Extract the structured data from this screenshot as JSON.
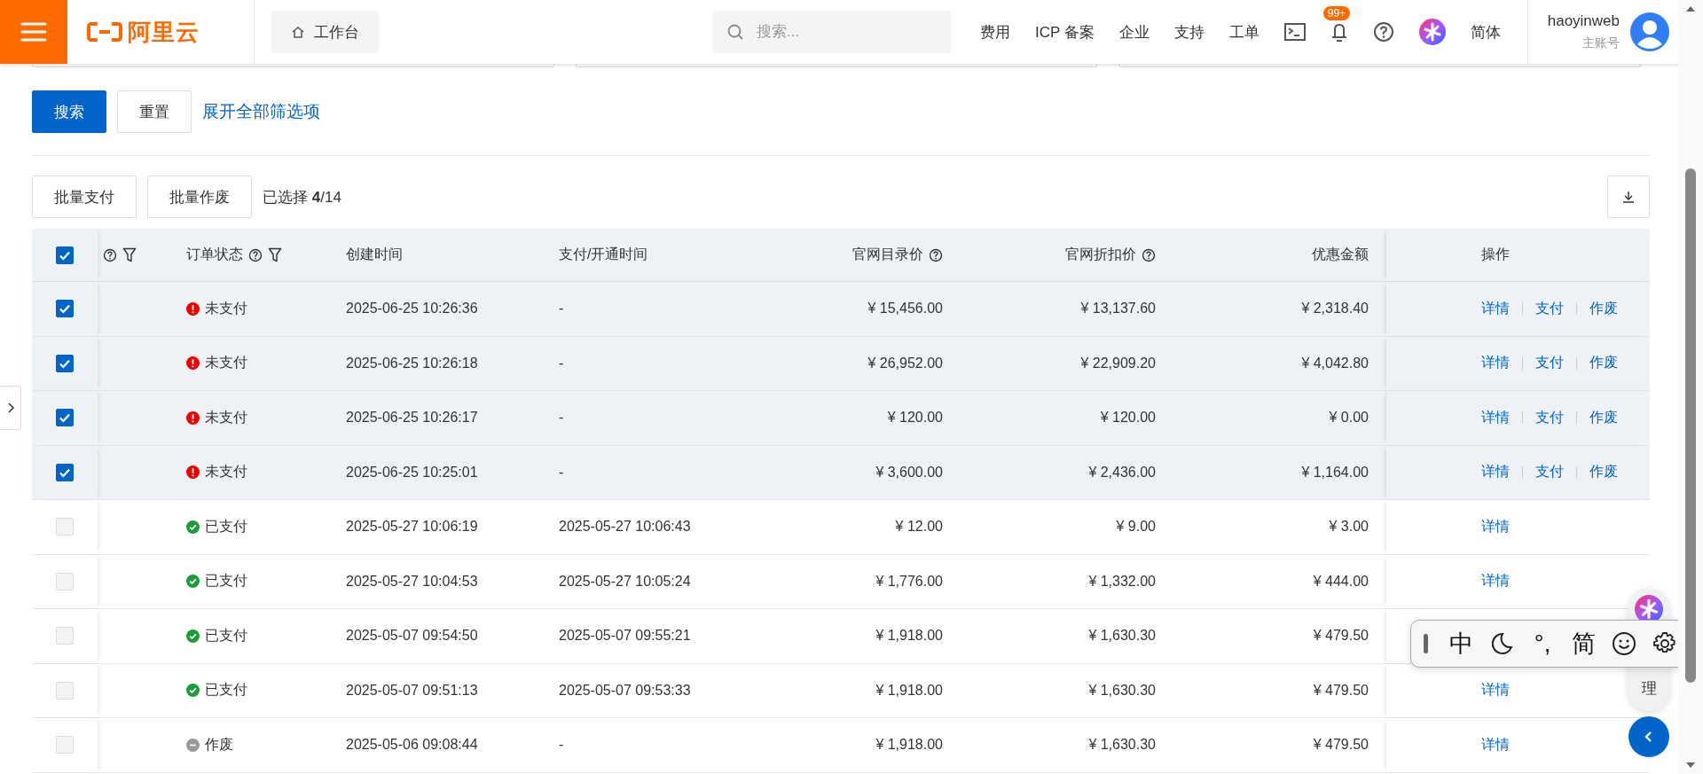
{
  "header": {
    "logo": "阿里云",
    "workbench": "工作台",
    "search": {
      "placeholder": "搜索..."
    },
    "nav": [
      "费用",
      "ICP 备案",
      "企业",
      "支持",
      "工单"
    ],
    "notifications_badge": "99+",
    "language": "简体",
    "user": {
      "name": "haoyinweb",
      "role": "主账号"
    }
  },
  "filter_actions": {
    "search": "搜索",
    "reset": "重置",
    "expand": "展开全部筛选项"
  },
  "batch": {
    "buttons": [
      "批量支付",
      "批量作废"
    ],
    "selection": "已选择 **4**/14"
  },
  "table": {
    "select_all": {
      "checked": true
    },
    "columns": [
      {
        "help": true,
        "filter": true
      },
      {
        "label": "订单状态",
        "help": true,
        "filter": true
      },
      {
        "label": "创建时间"
      },
      {
        "label": "支付/开通时间"
      },
      {
        "label": "官网目录价",
        "help": true
      },
      {
        "label": "官网折扣价",
        "help": true
      },
      {
        "label": "优惠金额"
      },
      {
        "label": "操作"
      }
    ],
    "rows": [
      {
        "selected": true,
        "status": {
          "kind": "unpaid",
          "label": "未支付"
        },
        "created": "2025-06-25 10:26:36",
        "paid": "-",
        "list_price": "¥ 15,456.00",
        "discount_price": "¥ 13,137.60",
        "discount_amount": "¥ 2,318.40",
        "actions": [
          "详情",
          "支付",
          "作废"
        ]
      },
      {
        "selected": true,
        "status": {
          "kind": "unpaid",
          "label": "未支付"
        },
        "created": "2025-06-25 10:26:18",
        "paid": "-",
        "list_price": "¥ 26,952.00",
        "discount_price": "¥ 22,909.20",
        "discount_amount": "¥ 4,042.80",
        "actions": [
          "详情",
          "支付",
          "作废"
        ]
      },
      {
        "selected": true,
        "status": {
          "kind": "unpaid",
          "label": "未支付"
        },
        "created": "2025-06-25 10:26:17",
        "paid": "-",
        "list_price": "¥ 120.00",
        "discount_price": "¥ 120.00",
        "discount_amount": "¥ 0.00",
        "actions": [
          "详情",
          "支付",
          "作废"
        ]
      },
      {
        "selected": true,
        "status": {
          "kind": "unpaid",
          "label": "未支付"
        },
        "created": "2025-06-25 10:25:01",
        "paid": "-",
        "list_price": "¥ 3,600.00",
        "discount_price": "¥ 2,436.00",
        "discount_amount": "¥ 1,164.00",
        "actions": [
          "详情",
          "支付",
          "作废"
        ]
      },
      {
        "selected": false,
        "status": {
          "kind": "paid",
          "label": "已支付"
        },
        "created": "2025-05-27 10:06:19",
        "paid": "2025-05-27 10:06:43",
        "list_price": "¥ 12.00",
        "discount_price": "¥ 9.00",
        "discount_amount": "¥ 3.00",
        "actions": [
          "详情"
        ]
      },
      {
        "selected": false,
        "status": {
          "kind": "paid",
          "label": "已支付"
        },
        "created": "2025-05-27 10:04:53",
        "paid": "2025-05-27 10:05:24",
        "list_price": "¥ 1,776.00",
        "discount_price": "¥ 1,332.00",
        "discount_amount": "¥ 444.00",
        "actions": [
          "详情"
        ]
      },
      {
        "selected": false,
        "status": {
          "kind": "paid",
          "label": "已支付"
        },
        "created": "2025-05-07 09:54:50",
        "paid": "2025-05-07 09:55:21",
        "list_price": "¥ 1,918.00",
        "discount_price": "¥ 1,630.30",
        "discount_amount": "¥ 479.50",
        "actions": []
      },
      {
        "selected": false,
        "status": {
          "kind": "paid",
          "label": "已支付"
        },
        "created": "2025-05-07 09:51:13",
        "paid": "2025-05-07 09:53:33",
        "list_price": "¥ 1,918.00",
        "discount_price": "¥ 1,630.30",
        "discount_amount": "¥ 479.50",
        "actions": [
          "详情"
        ]
      },
      {
        "selected": false,
        "status": {
          "kind": "void",
          "label": "作废"
        },
        "created": "2025-05-06 09:08:44",
        "paid": "-",
        "list_price": "¥ 1,918.00",
        "discount_price": "¥ 1,630.30",
        "discount_amount": "¥ 479.50",
        "actions": [
          "详情"
        ]
      }
    ]
  },
  "assistant": {
    "label": "理"
  },
  "ime_toolbar": {
    "items": [
      {
        "kind": "text",
        "label": "中"
      },
      {
        "kind": "moon"
      },
      {
        "kind": "text",
        "label": "°,"
      },
      {
        "kind": "text",
        "label": "简"
      },
      {
        "kind": "smile"
      },
      {
        "kind": "gear"
      }
    ]
  }
}
